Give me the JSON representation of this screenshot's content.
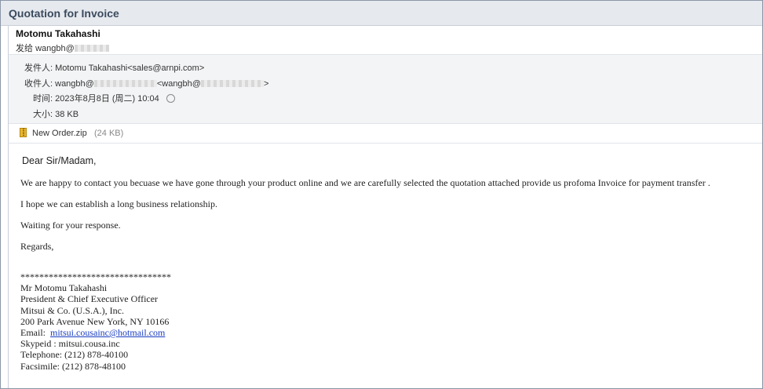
{
  "window": {
    "title": "Quotation for Invoice"
  },
  "sender": {
    "name": "Motomu Takahashi",
    "to_label": "发给",
    "to_partial": "wangbh@"
  },
  "details": {
    "from_label": "发件人:",
    "from_value": "Motomu Takahashi<sales@arnpi.com>",
    "to_label": "收件人:",
    "to_prefix": "wangbh@",
    "to_open": "<wangbh@",
    "to_close": ">",
    "time_label": "时间:",
    "time_value": "2023年8月8日 (周二) 10:04",
    "size_label": "大小:",
    "size_value": "38 KB"
  },
  "attachment": {
    "name": "New Order.zip",
    "size": "(24 KB)"
  },
  "body": {
    "greeting": "Dear Sir/Madam,",
    "p1": "We are happy to contact you becuase we have gone through your product online and we are carefully selected the quotation attached provide us profoma Invoice for payment transfer .",
    "p2": "I hope we can establish a long business relationship.",
    "p3": "Waiting for your response.",
    "p4": "Regards,"
  },
  "signature": {
    "divider": "********************************",
    "name": "Mr Motomu Takahashi",
    "role": "President & Chief Executive Officer",
    "company": "Mitsui & Co. (U.S.A.), Inc.",
    "address": "200 Park Avenue New York, NY 10166",
    "email_label": "Email:",
    "email": "mitsui.cousainc@hotmail.com",
    "skype": "Skypeid : mitsui.cousa.inc",
    "telephone": "Telephone: (212) 878-40100",
    "fax": "Facsimile: (212) 878-48100"
  }
}
